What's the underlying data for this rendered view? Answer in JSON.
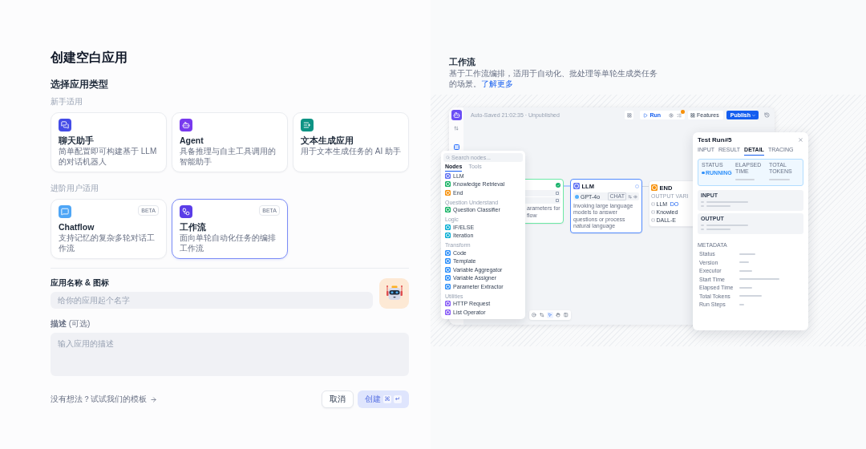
{
  "dialog": {
    "title": "创建空白应用"
  },
  "app_types": {
    "heading": "选择应用类型",
    "groups": [
      {
        "label": "新手适用",
        "cards": [
          {
            "kind": "chat",
            "title": "聊天助手",
            "description": "简单配置即可构建基于 LLM 的对话机器人",
            "selected": false
          },
          {
            "kind": "agent",
            "title": "Agent",
            "description": "具备推理与自主工具调用的智能助手",
            "selected": false
          },
          {
            "kind": "completion",
            "title": "文本生成应用",
            "description": "用于文本生成任务的 AI 助手",
            "selected": false
          }
        ]
      },
      {
        "label": "进阶用户适用",
        "cards": [
          {
            "kind": "chatflow",
            "title": "Chatflow",
            "badge": "BETA",
            "description": "支持记忆的复杂多轮对话工作流",
            "selected": false
          },
          {
            "kind": "workflow",
            "title": "工作流",
            "badge": "BETA",
            "description": "面向单轮自动化任务的编排工作流",
            "selected": true
          }
        ]
      }
    ]
  },
  "name_field": {
    "label": "应用名称 & 图标",
    "placeholder": "给你的应用起个名字"
  },
  "description_field": {
    "label": "**描述** (可选)",
    "placeholder": "输入应用的描述"
  },
  "footer": {
    "template_link": "没有想法？试试我们的模板",
    "buttons": [
      {
        "kind": "cancel",
        "label": "取消",
        "disabled": false
      },
      {
        "kind": "create",
        "label": "创建",
        "keys": [
          "⌘",
          "↵"
        ],
        "disabled": true
      }
    ]
  },
  "preview": {
    "title": "工作流",
    "description": "基于工作流编排，适用于自动化、批处理等单轮生成类任务的场景。",
    "link": "了解更多",
    "screenshot": {
      "status": "Auto-Saved 21:02:35 · Unpublished",
      "run_button": "Run",
      "checklist_alert": true,
      "features_button": "Features",
      "publish_button": "Publish",
      "node_panel": {
        "search_placeholder": "Search nodes...",
        "tabs": [
          {
            "label": "Nodes",
            "selected": true
          },
          {
            "label": "Tools",
            "selected": false
          }
        ],
        "groups": [
          {
            "items": [
              {
                "label": "LLM",
                "color": "#6172f3"
              },
              {
                "label": "Knowledge Retrieval",
                "color": "#16b364"
              },
              {
                "label": "End",
                "color": "#f79009"
              }
            ]
          },
          {
            "heading": "Question Understand",
            "items": [
              {
                "label": "Question Classifier",
                "color": "#16b364"
              }
            ]
          },
          {
            "heading": "Logic",
            "items": [
              {
                "label": "IF/ELSE",
                "color": "#06aed4"
              },
              {
                "label": "Iteration",
                "color": "#06aed4"
              }
            ]
          },
          {
            "heading": "Transform",
            "items": [
              {
                "label": "Code",
                "color": "#2e90fa"
              },
              {
                "label": "Template",
                "color": "#2e90fa"
              },
              {
                "label": "Variable Aggregator",
                "color": "#2e90fa"
              },
              {
                "label": "Variable Assigner",
                "color": "#2e90fa"
              },
              {
                "label": "Parameter Extractor",
                "color": "#2e90fa"
              }
            ]
          },
          {
            "heading": "Utilities",
            "items": [
              {
                "label": "HTTP Request",
                "color": "#875bf7"
              },
              {
                "label": "List Operator",
                "color": "#875bf7"
              }
            ]
          }
        ]
      },
      "nodes": [
        {
          "kind": "start",
          "succeeded": true,
          "selected": false,
          "lines": [
            "arameters for",
            "flow"
          ]
        },
        {
          "kind": "llm",
          "selected": true,
          "title": "LLM",
          "model": "GPT-4o",
          "mode": "CHAT",
          "description": "Invoking large language models to answer questions or process natural language"
        },
        {
          "kind": "end",
          "selected": false,
          "title": "END",
          "section": "OUTPUT VARI",
          "outputs": [
            {
              "label": "LLM",
              "tag": "DO"
            },
            {
              "label": "Knowled"
            },
            {
              "label": "DALL-E"
            }
          ]
        }
      ],
      "canvas_tools": [
        {
          "kind": "circle",
          "selected": false
        },
        {
          "kind": "crop",
          "selected": false
        },
        {
          "kind": "pointer",
          "selected": true
        },
        {
          "kind": "hand",
          "selected": false
        },
        {
          "kind": "columns",
          "selected": false
        }
      ],
      "run_panel": {
        "title": "Test Run#5",
        "tabs": [
          {
            "label": "INPUT",
            "selected": false
          },
          {
            "label": "RESULT",
            "selected": false
          },
          {
            "label": "DETAIL",
            "selected": true
          },
          {
            "label": "TRACING",
            "selected": false
          }
        ],
        "status_labels": [
          "STATUS",
          "ELAPSED TIME",
          "TOTAL TOKENS"
        ],
        "status_value": "RUNNING",
        "sections": [
          "INPUT",
          "OUTPUT"
        ],
        "metadata_heading": "METADATA",
        "metadata_rows": [
          "Status",
          "Version",
          "Executor",
          "Start Time",
          "Elapsed Time",
          "Total Tokens",
          "Run Steps"
        ]
      }
    }
  }
}
